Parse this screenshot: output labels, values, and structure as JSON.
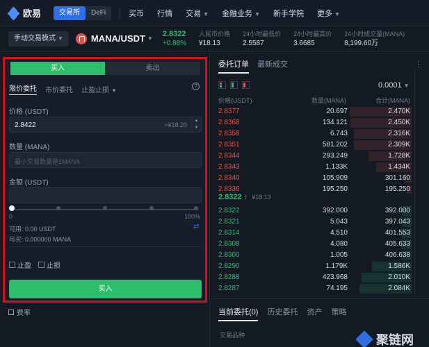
{
  "nav": {
    "logo": "欧易",
    "segments": [
      "交易所",
      "DeFi"
    ],
    "items": [
      "买币",
      "行情",
      "交易",
      "金融业务",
      "新手学院",
      "更多"
    ]
  },
  "ticker": {
    "mode": "手动交易模式",
    "pair": "MANA/USDT",
    "price": "2.8322",
    "change": "+0.88%",
    "stats": [
      {
        "label": "人民币价格",
        "value": "¥18.13"
      },
      {
        "label": "24小时最低价",
        "value": "2.5587"
      },
      {
        "label": "24小时最高价",
        "value": "3.6685"
      },
      {
        "label": "24小时成交量(MANA)",
        "value": "8,199.60万"
      }
    ]
  },
  "form": {
    "tab_buy": "买入",
    "tab_sell": "卖出",
    "order_types": [
      "限价委托",
      "市价委托",
      "止盈止损"
    ],
    "help": "?",
    "price_label": "价格 (USDT)",
    "price_value": "2.8422",
    "price_approx": "≈¥18.20",
    "amount_label": "数量 (MANA)",
    "amount_placeholder": "最小交易数量是1MANA",
    "total_label": "金额 (USDT)",
    "slider_min": "0",
    "slider_max": "100%",
    "slider_fraction": 0,
    "available": "可用: 0.00 USDT",
    "can_buy": "可买: 0.000000 MANA",
    "take_profit": "止盈",
    "stop_loss": "止损",
    "submit": "买入"
  },
  "fee_label": "费率",
  "orderbook": {
    "tabs": [
      "委托订单",
      "最新成交"
    ],
    "precision": "0.0001",
    "columns": [
      "价格(USDT)",
      "数量(MANA)",
      "合计(MANA)"
    ],
    "asks": [
      {
        "price": "2.8377",
        "amount": "20.697",
        "total": "2.470K"
      },
      {
        "price": "2.8368",
        "amount": "134.121",
        "total": "2.450K"
      },
      {
        "price": "2.8358",
        "amount": "6.743",
        "total": "2.316K"
      },
      {
        "price": "2.8351",
        "amount": "581.202",
        "total": "2.309K"
      },
      {
        "price": "2.8344",
        "amount": "293.249",
        "total": "1.728K"
      },
      {
        "price": "2.8343",
        "amount": "1.133K",
        "total": "1.434K"
      },
      {
        "price": "2.8340",
        "amount": "105.909",
        "total": "301.160"
      },
      {
        "price": "2.8336",
        "amount": "195.250",
        "total": "195.250"
      }
    ],
    "mid_price": "2.8322 ↑",
    "mid_cny": "¥18.13",
    "bids": [
      {
        "price": "2.8322",
        "amount": "392.000",
        "total": "392.000"
      },
      {
        "price": "2.8321",
        "amount": "5.043",
        "total": "397.043"
      },
      {
        "price": "2.8314",
        "amount": "4.510",
        "total": "401.553"
      },
      {
        "price": "2.8308",
        "amount": "4.080",
        "total": "405.633"
      },
      {
        "price": "2.8300",
        "amount": "1.005",
        "total": "406.638"
      },
      {
        "price": "2.8290",
        "amount": "1.179K",
        "total": "1.586K"
      },
      {
        "price": "2.8288",
        "amount": "423.968",
        "total": "2.010K"
      },
      {
        "price": "2.8287",
        "amount": "74.195",
        "total": "2.084K"
      }
    ]
  },
  "bottom": {
    "tabs": [
      "当前委托(0)",
      "历史委托",
      "资产",
      "策略"
    ],
    "column": "交易品种"
  },
  "watermark": "聚链网",
  "colors": {
    "buy": "#2ebd6a",
    "sell": "#e2534b",
    "accent": "#2f6fe4",
    "highlight": "#d0111a"
  }
}
